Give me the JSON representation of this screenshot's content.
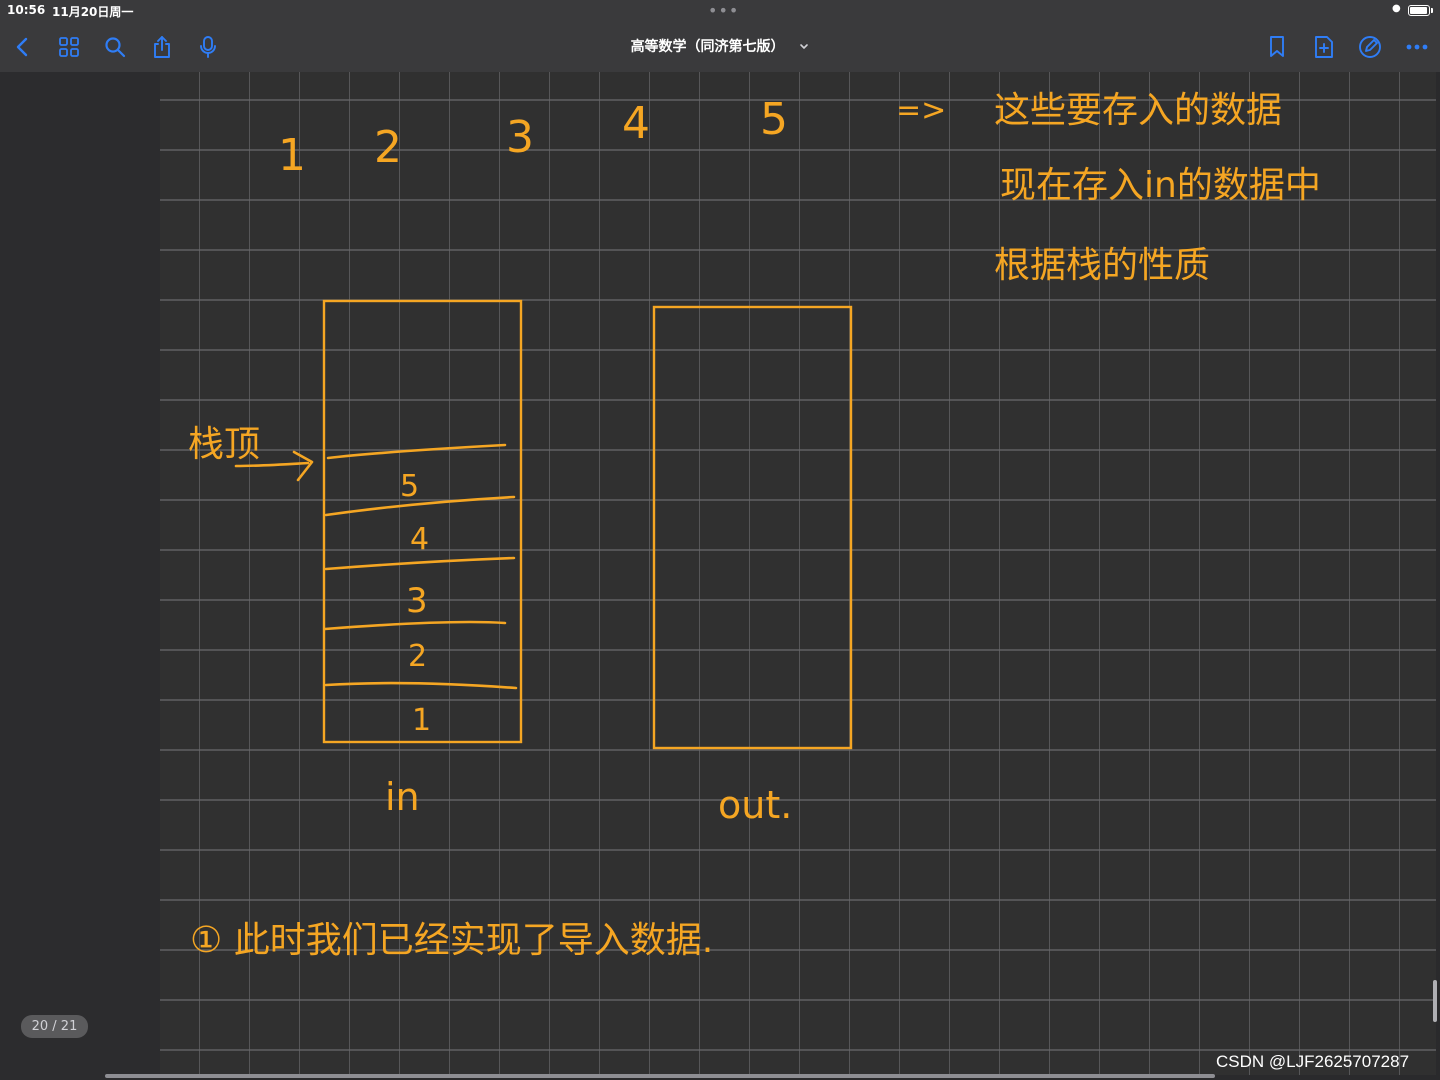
{
  "status_bar": {
    "time": "10:56",
    "date": "11月20日周一",
    "multitask_dots": "•••"
  },
  "toolbar": {
    "document_title": "高等数学（同济第七版）",
    "left_icons": [
      "back-icon",
      "thumbnails-icon",
      "search-icon",
      "share-icon",
      "microphone-icon"
    ],
    "right_icons": [
      "bookmark-icon",
      "add-page-icon",
      "pen-icon",
      "more-icon"
    ],
    "accent_color": "#2f7df6"
  },
  "page_indicator": "20 / 21",
  "watermark": "CSDN @LJF2625707287",
  "notes": {
    "ink_color": "#f5a623",
    "top_numbers": [
      "1",
      "2",
      "3",
      "4",
      "5"
    ],
    "arrow_symbol": "=>",
    "right_lines": [
      "这些要存入的数据",
      "现在存入in的数据中",
      "根据栈的性质"
    ],
    "stack_top_label": "栈顶",
    "in_stack_values": [
      "5",
      "4",
      "3",
      "2",
      "1"
    ],
    "in_label": "in",
    "out_label": "out.",
    "bottom_note": "① 此时我们已经实现了导入数据."
  }
}
